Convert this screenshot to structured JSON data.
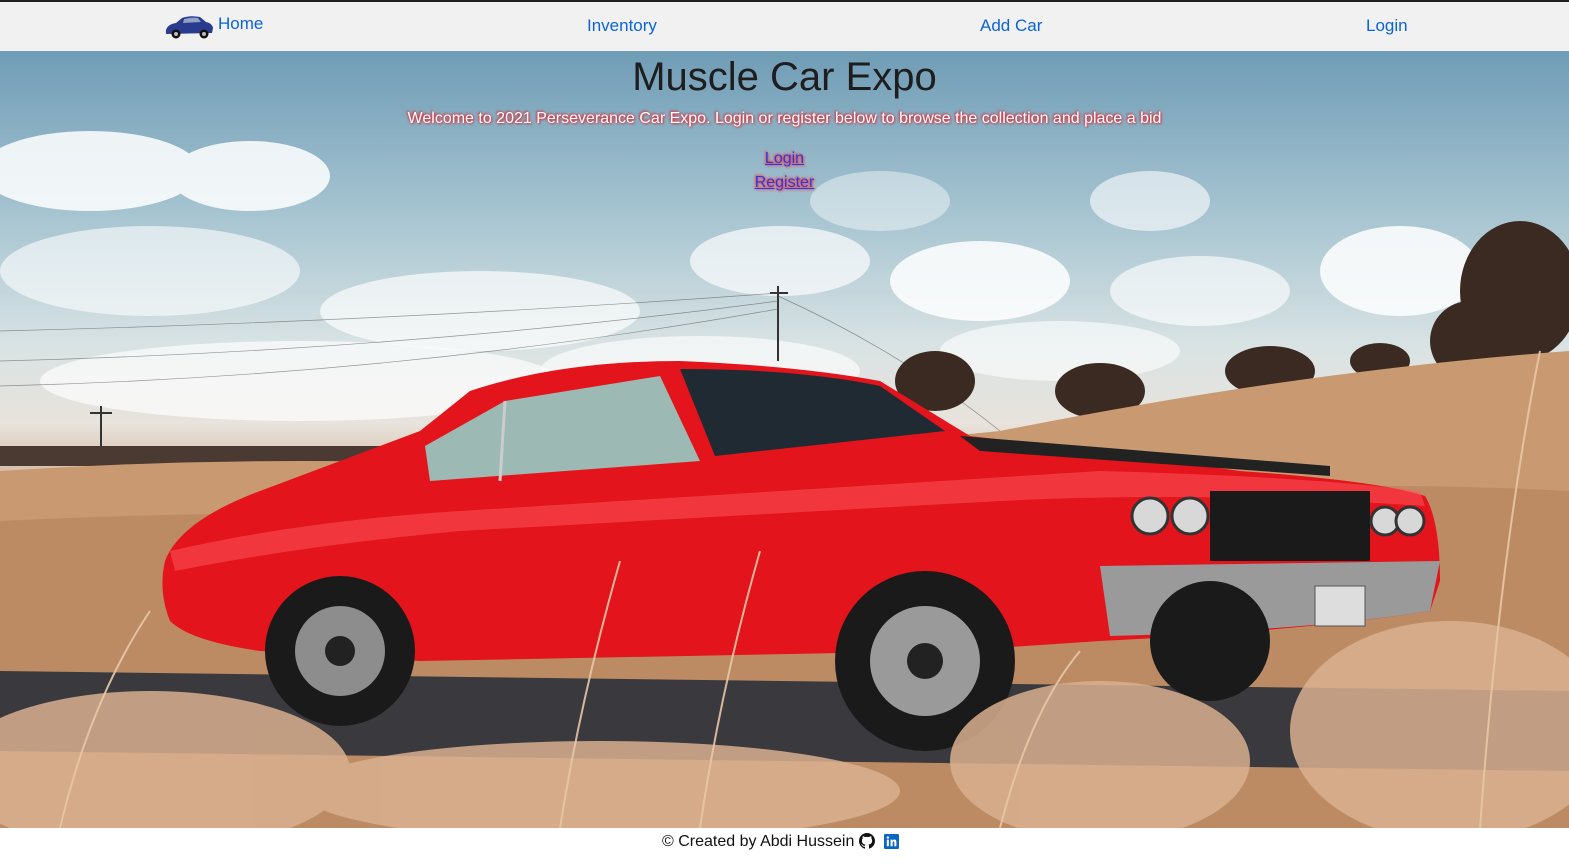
{
  "nav": {
    "home_label": "Home",
    "inventory_label": "Inventory",
    "addcar_label": "Add Car",
    "login_label": "Login",
    "logo_icon": "car-logo-icon"
  },
  "hero": {
    "title": "Muscle Car Expo",
    "welcome": "Welcome to 2021 Perseverance Car Expo. Login or register below to browse the collection and place a bid",
    "login_link": "Login",
    "register_link": "Register"
  },
  "footer": {
    "text": "© Created by Abdi Hussein",
    "icons": [
      "github-icon",
      "linkedin-icon"
    ]
  },
  "colors": {
    "link": "#0b63d6",
    "navbar_bg": "#f1f1f1",
    "car_red": "#e3141b",
    "text_shadow_red": "#e0202a"
  }
}
